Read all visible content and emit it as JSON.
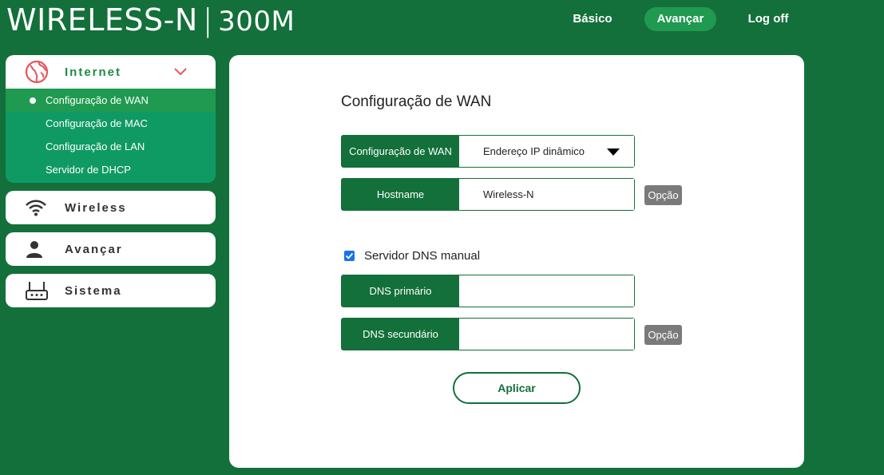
{
  "header": {
    "brand_main": "WIRELESS-N",
    "brand_sep": "|",
    "brand_sub": "300M",
    "nav": {
      "basic": "Básico",
      "advanced": "Avançar",
      "logoff": "Log off"
    }
  },
  "sidebar": {
    "internet": {
      "label": "Internet",
      "icon": "globe-icon",
      "items": [
        "Configuração de WAN",
        "Configuração de MAC",
        "Configuração de LAN",
        "Servidor de DHCP"
      ]
    },
    "wireless": {
      "label": "Wireless",
      "icon": "wifi-icon"
    },
    "advanced": {
      "label": "Avançar",
      "icon": "user-icon"
    },
    "system": {
      "label": "Sistema",
      "icon": "router-icon"
    }
  },
  "panel": {
    "title": "Configuração de WAN",
    "wan": {
      "label": "Configuração de WAN",
      "value": "Endereço IP dinâmico"
    },
    "hostname": {
      "label": "Hostname",
      "value": "Wireless-N"
    },
    "option_label": "Opção",
    "dns_manual": {
      "label": "Servidor DNS manual",
      "checked": true
    },
    "dns_primary": {
      "label": "DNS primário",
      "value": ""
    },
    "dns_secondary": {
      "label": "DNS secundário",
      "value": ""
    },
    "apply_label": "Aplicar"
  },
  "colors": {
    "background": "#13703a",
    "active_tab": "#1f9a50",
    "submenu": "#0f9a63",
    "accent_red": "#e8565a",
    "checkbox": "#1a73e8"
  }
}
